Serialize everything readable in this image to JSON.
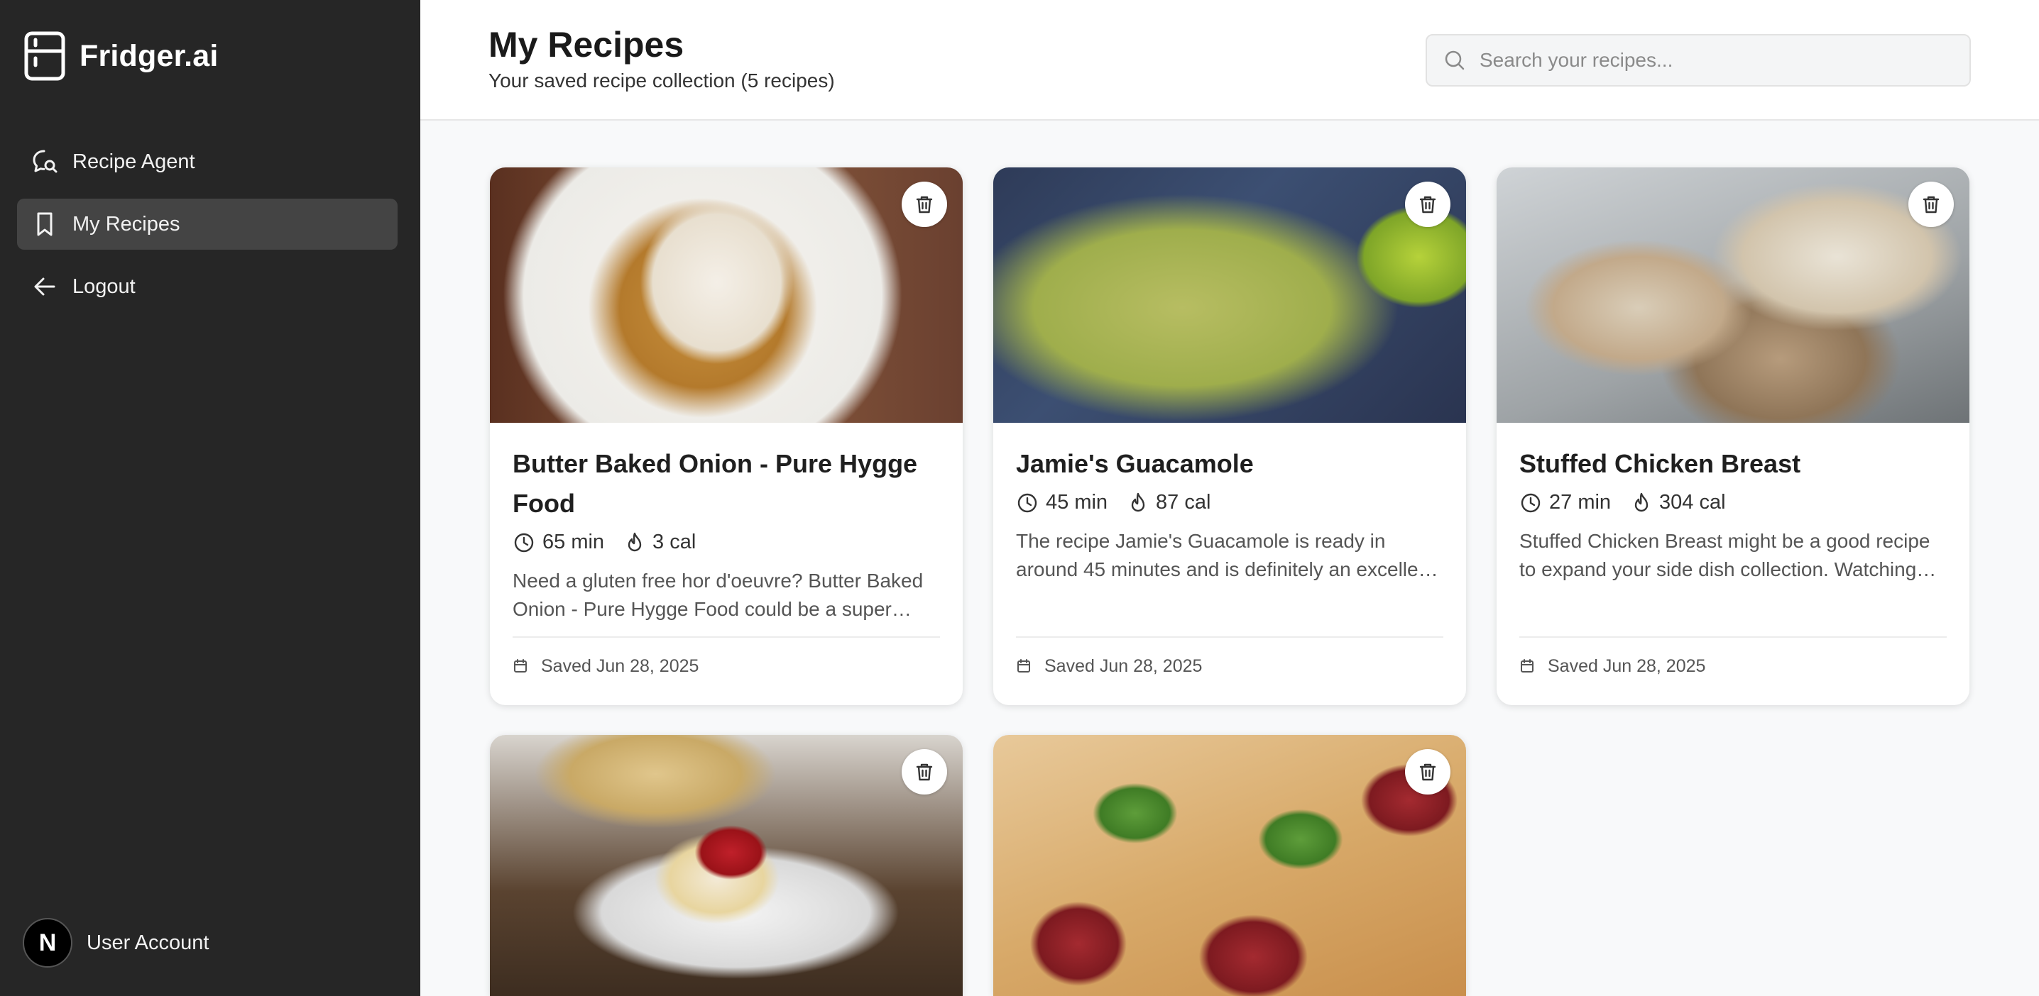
{
  "app": {
    "name": "Fridger.ai"
  },
  "sidebar": {
    "items": [
      {
        "label": "Recipe Agent",
        "icon": "chat-search-icon",
        "active": false
      },
      {
        "label": "My Recipes",
        "icon": "bookmark-icon",
        "active": true
      },
      {
        "label": "Logout",
        "icon": "arrow-left-icon",
        "active": false
      }
    ],
    "user": {
      "avatar_letter": "N",
      "label": "User Account"
    }
  },
  "header": {
    "title": "My Recipes",
    "subtitle": "Your saved recipe collection (5 recipes)",
    "search_placeholder": "Search your recipes..."
  },
  "recipes": [
    {
      "title": "Butter Baked Onion - Pure Hygge Food",
      "time": "65 min",
      "calories": "3 cal",
      "description": "Need a gluten free hor d'oeuvre? Butter Baked Onion - Pure Hygge Food could be a super recipe to try.",
      "saved": "Saved Jun 28, 2025"
    },
    {
      "title": "Jamie's Guacamole",
      "time": "45 min",
      "calories": "87 cal",
      "description": "The recipe Jamie's Guacamole is ready in around 45 minutes and is definitely an excellent option.",
      "saved": "Saved Jun 28, 2025"
    },
    {
      "title": "Stuffed Chicken Breast",
      "time": "27 min",
      "calories": "304 cal",
      "description": "Stuffed Chicken Breast might be a good recipe to expand your side dish collection. Watching your figure?",
      "saved": "Saved Jun 28, 2025"
    },
    {
      "title": "",
      "time": "",
      "calories": "",
      "description": "",
      "saved": ""
    },
    {
      "title": "",
      "time": "",
      "calories": "",
      "description": "",
      "saved": ""
    }
  ],
  "colors": {
    "sidebar_bg": "#262626",
    "active_item_bg": "#444444",
    "page_bg": "#f8f9fa"
  }
}
